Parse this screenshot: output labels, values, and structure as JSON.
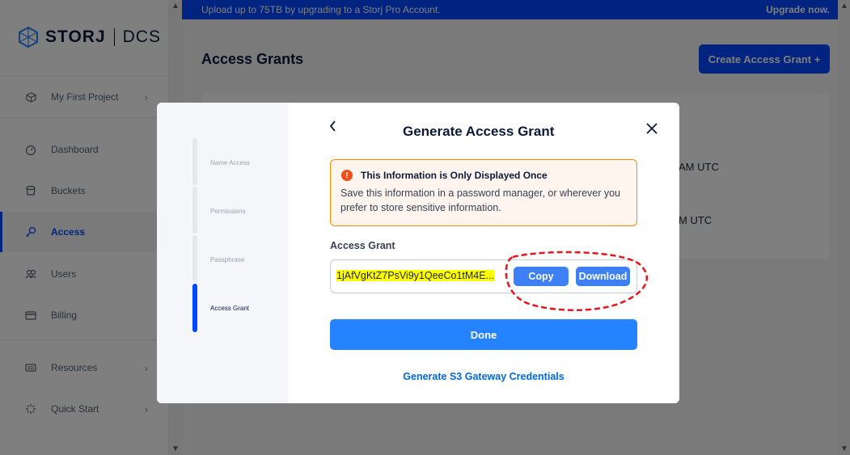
{
  "sidebar": {
    "logo_text": "STORJ",
    "logo_suffix": "DCS",
    "project": "My First Project",
    "items": [
      {
        "label": "Dashboard",
        "icon": "dashboard-icon"
      },
      {
        "label": "Buckets",
        "icon": "bucket-icon"
      },
      {
        "label": "Access",
        "icon": "key-icon",
        "active": true
      },
      {
        "label": "Users",
        "icon": "users-icon"
      },
      {
        "label": "Billing",
        "icon": "billing-icon"
      }
    ],
    "resources": "Resources",
    "quick_start": "Quick Start"
  },
  "banner": {
    "text": "Upload up to 75TB by upgrading to a Storj Pro Account.",
    "link": "Upgrade now."
  },
  "page": {
    "title": "Access Grants",
    "create_button": "Create Access Grant +",
    "row_time_1": "AM UTC",
    "row_time_2": "M UTC"
  },
  "modal": {
    "steps": [
      {
        "label": "Name Access"
      },
      {
        "label": "Permissions"
      },
      {
        "label": "Passphrase"
      },
      {
        "label": "Access Grant",
        "active": true
      }
    ],
    "title": "Generate Access Grant",
    "warning": {
      "heading": "This Information is Only Displayed Once",
      "body": "Save this information in a password manager, or wherever you prefer to store sensitive information."
    },
    "access_grant_label": "Access Grant",
    "access_grant_value": "1jAfVgKtZ7PsVi9y1QeeCo1tM4E...",
    "copy_button": "Copy",
    "download_button": "Download",
    "done_button": "Done",
    "s3_link": "Generate S3 Gateway Credentials"
  },
  "colors": {
    "brand_blue": "#0149ff",
    "button_blue": "#2683ff",
    "warning_orange": "#ff8a00",
    "highlight_yellow": "#ffff00",
    "annotation_red": "#e8141c"
  }
}
